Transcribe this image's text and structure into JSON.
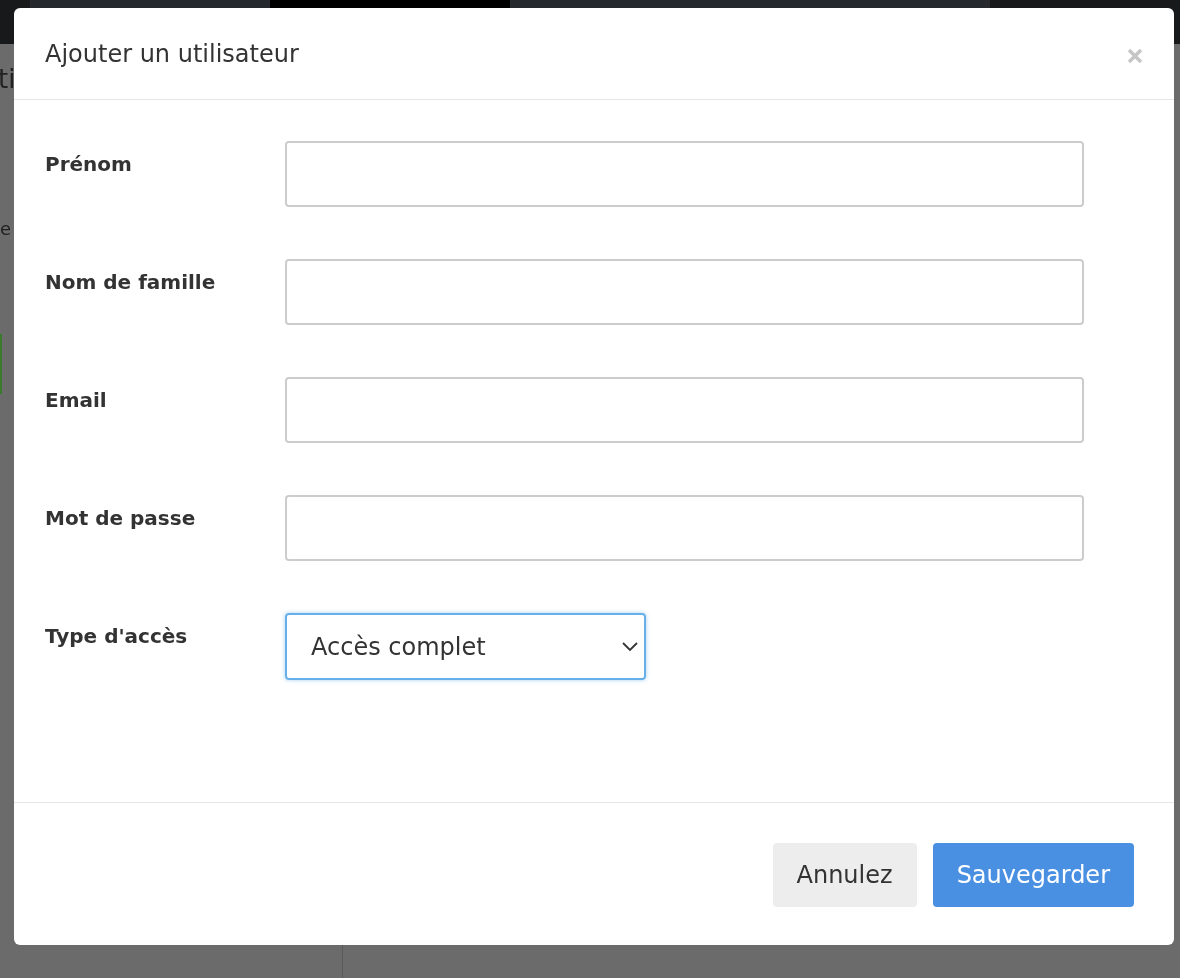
{
  "background": {
    "nav_tabs": [
      {
        "selected": false
      },
      {
        "selected": true
      },
      {
        "selected": false
      },
      {
        "selected": false
      }
    ],
    "fragments": [
      "ti",
      "e"
    ]
  },
  "dialog": {
    "title": "Ajouter un utilisateur",
    "fields": [
      {
        "kind": "text",
        "label": "Prénom",
        "focused": false
      },
      {
        "kind": "text",
        "label": "Nom de famille",
        "focused": false
      },
      {
        "kind": "text",
        "label": "Email",
        "focused": false
      },
      {
        "kind": "text",
        "label": "Mot de passe",
        "focused": false
      },
      {
        "kind": "select",
        "label": "Type d'accès",
        "value": "Accès complet",
        "focused": true
      }
    ],
    "buttons": [
      {
        "label": "Annulez",
        "kind": "secondary"
      },
      {
        "label": "Sauvegarder",
        "kind": "primary"
      }
    ]
  }
}
